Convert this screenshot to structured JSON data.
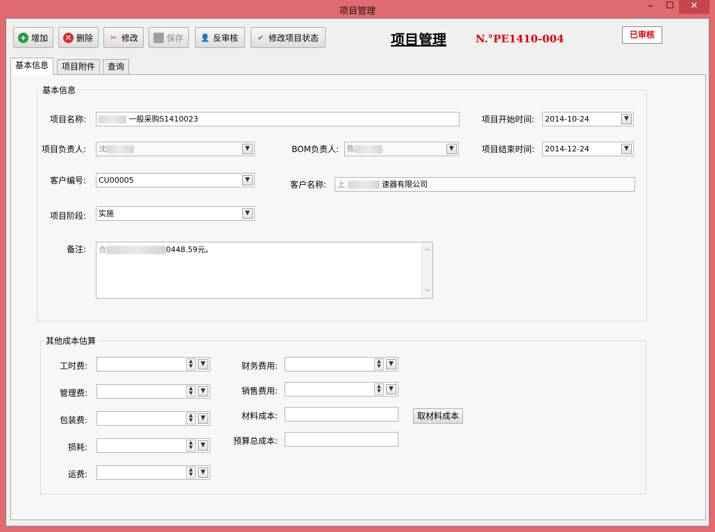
{
  "window": {
    "title": "项目管理",
    "min": "–",
    "max": "☐",
    "close": "✕"
  },
  "toolbar": {
    "add": "增加",
    "delete": "删除",
    "edit": "修改",
    "save": "保存",
    "unaudit": "反审核",
    "change_status": "修改项目状态",
    "title": "项目管理",
    "code": "N.°PE1410-004",
    "stamp": "已审核"
  },
  "tabs": [
    "基本信息",
    "项目附件",
    "查询"
  ],
  "basic": {
    "legend": "基本信息",
    "project_name_label": "项目名称:",
    "project_name_value": "一般采购S1410023",
    "start_label": "项目开始时间:",
    "start_value": "2014-10-24",
    "manager_label": "项目负责人:",
    "manager_value": "沈",
    "bom_label": "BOM负责人:",
    "bom_value": "陈",
    "end_label": "项目结束时间:",
    "end_value": "2014-12-24",
    "cust_no_label": "客户编号:",
    "cust_no_value": "CU00005",
    "cust_name_label": "客户名称:",
    "cust_name_prefix": "上",
    "cust_name_value": "速器有限公司",
    "phase_label": "项目阶段:",
    "phase_value": "实施",
    "remark_label": "备注:",
    "remark_prefix": "合",
    "remark_value": "0448.59元。"
  },
  "cost": {
    "legend": "其他成本估算",
    "labor": "工时费:",
    "mgmt": "管理费:",
    "pack": "包装费:",
    "loss": "损耗:",
    "freight": "运费:",
    "finance": "财务费用:",
    "sales": "销售费用:",
    "material": "材料成本:",
    "budget": "预算总成本:",
    "get_material_btn": "取材料成本"
  }
}
